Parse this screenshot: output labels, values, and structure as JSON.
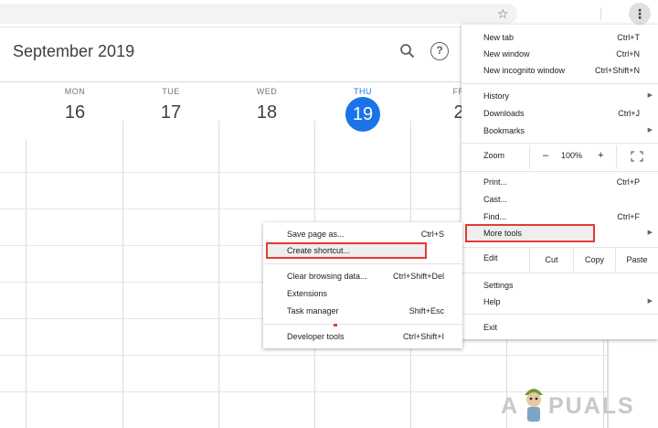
{
  "calendar": {
    "month_title": "September 2019",
    "days": [
      {
        "name": "MON",
        "num": "16",
        "today": false
      },
      {
        "name": "TUE",
        "num": "17",
        "today": false
      },
      {
        "name": "WED",
        "num": "18",
        "today": false
      },
      {
        "name": "THU",
        "num": "19",
        "today": true
      },
      {
        "name": "FR",
        "num": "2",
        "today": false
      }
    ]
  },
  "chrome_menu": {
    "new_tab": {
      "label": "New tab",
      "shortcut": "Ctrl+T"
    },
    "new_window": {
      "label": "New window",
      "shortcut": "Ctrl+N"
    },
    "new_incognito": {
      "label": "New incognito window",
      "shortcut": "Ctrl+Shift+N"
    },
    "history": {
      "label": "History"
    },
    "downloads": {
      "label": "Downloads",
      "shortcut": "Ctrl+J"
    },
    "bookmarks": {
      "label": "Bookmarks"
    },
    "zoom": {
      "label": "Zoom",
      "minus": "–",
      "value": "100%",
      "plus": "+"
    },
    "print": {
      "label": "Print...",
      "shortcut": "Ctrl+P"
    },
    "cast": {
      "label": "Cast..."
    },
    "find": {
      "label": "Find...",
      "shortcut": "Ctrl+F"
    },
    "more_tools": {
      "label": "More tools"
    },
    "edit": {
      "label": "Edit",
      "cut": "Cut",
      "copy": "Copy",
      "paste": "Paste"
    },
    "settings": {
      "label": "Settings"
    },
    "help": {
      "label": "Help"
    },
    "exit": {
      "label": "Exit"
    }
  },
  "more_tools_menu": {
    "save_page": {
      "label": "Save page as...",
      "shortcut": "Ctrl+S"
    },
    "create_shortcut": {
      "label": "Create shortcut..."
    },
    "clear_browsing": {
      "label": "Clear browsing data...",
      "shortcut": "Ctrl+Shift+Del"
    },
    "extensions": {
      "label": "Extensions"
    },
    "task_manager": {
      "label": "Task manager",
      "shortcut": "Shift+Esc"
    },
    "developer_tools": {
      "label": "Developer tools",
      "shortcut": "Ctrl+Shift+I"
    }
  },
  "watermark": {
    "prefix": "A",
    "suffix": "PUALS"
  },
  "icons": {
    "star": "☆",
    "kebab": "⋮",
    "help": "?",
    "submenu_arrow": "▶"
  },
  "colors": {
    "accent": "#1a73e8",
    "highlight_border": "#e53935"
  }
}
